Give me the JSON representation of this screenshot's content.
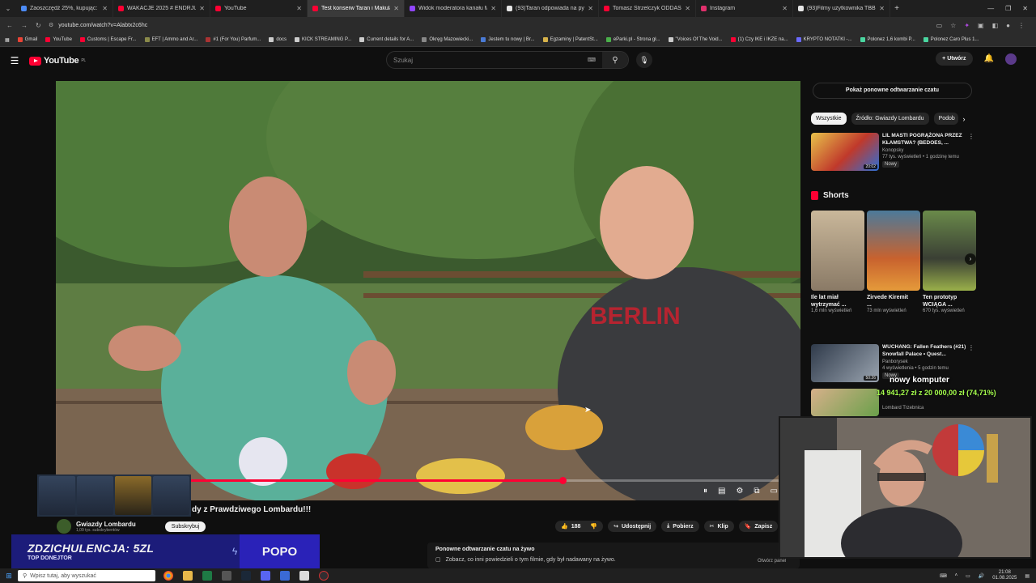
{
  "tabs": [
    {
      "title": "Zaoszczędź 25%, kupując: Bus I",
      "color": "#4c8bf5",
      "active": false
    },
    {
      "title": "WAKACJE 2025 # ENDRJU # ENTER",
      "color": "#ff0033",
      "active": false
    },
    {
      "title": "YouTube",
      "color": "#ff0033",
      "active": false
    },
    {
      "title": "Test konserw Taran i Makulach",
      "color": "#ff0033",
      "active": true
    },
    {
      "title": "Widok moderatora kanału Mar",
      "color": "#9146ff",
      "active": false
    },
    {
      "title": "(93)Taran odpowiada na pytani",
      "color": "#e6e6e6",
      "active": false
    },
    {
      "title": "Tomasz Strzelczyk ODDASZFAR",
      "color": "#ff0033",
      "active": false
    },
    {
      "title": "Instagram",
      "color": "#e1306c",
      "active": false
    },
    {
      "title": "(93)Filmy użytkownika TBBUPC",
      "color": "#e6e6e6",
      "active": false
    }
  ],
  "address": {
    "url": "youtube.com/watch?v=Alabtx2c6hc"
  },
  "bookmarks": [
    {
      "label": "Gmail",
      "color": "#ea4335"
    },
    {
      "label": "YouTube",
      "color": "#ff0033"
    },
    {
      "label": "Customs | Escape Fr...",
      "color": "#ff0033"
    },
    {
      "label": "EFT | Ammo and Ar...",
      "color": "#8a8a4a"
    },
    {
      "label": "#1 (For You) Parfum...",
      "color": "#aa3333"
    },
    {
      "label": "docs",
      "color": "#cccccc"
    },
    {
      "label": "KICK STREAMING P...",
      "color": "#cccccc"
    },
    {
      "label": "Current details for A...",
      "color": "#cccccc"
    },
    {
      "label": "Okręg Mazowiecki...",
      "color": "#888888"
    },
    {
      "label": "Jestem tu nowy | Br...",
      "color": "#4a7bd6"
    },
    {
      "label": "Egzaminy | PatentSt...",
      "color": "#d6b24a"
    },
    {
      "label": "eParki.pl - Strona gł...",
      "color": "#4ab04a"
    },
    {
      "label": "\"Voices Of The Void...",
      "color": "#cccccc"
    },
    {
      "label": "(1) Czy IKE i IKZE na...",
      "color": "#ff0033"
    },
    {
      "label": "KRYPTO NOTATKI -...",
      "color": "#6a6aff"
    },
    {
      "label": "Polonez 1,6 kombi P...",
      "color": "#4ad6a0"
    },
    {
      "label": "Polonez Caro Plus 1...",
      "color": "#4ad6a0"
    }
  ],
  "header": {
    "logo_text": "YouTube",
    "logo_region": "PL",
    "search_placeholder": "Szukaj",
    "create_label": "Utwórz"
  },
  "player": {
    "progress_fraction": 0.68
  },
  "video": {
    "title": "dy z Prawdziwego Lombardu!!!",
    "channel_name": "Gwiazdy Lombardu",
    "channel_subs": "1,09 tys. subskrybentów",
    "subscribe_label": "Subskrybuj",
    "likes": "188",
    "share_label": "Udostępnij",
    "download_label": "Pobierz",
    "clip_label": "Klip",
    "save_label": "Zapisz"
  },
  "chat_replay": {
    "title": "Ponowne odtwarzanie czatu na żywo",
    "body": "Zobacz, co inni powiedzieli o tym filmie, gdy był nadawany na żywo.",
    "open_panel": "Otwórz panel"
  },
  "sidebar": {
    "show_chat": "Pokaż ponowne odtwarzanie czatu",
    "chips": [
      "Wszystkie",
      "Źródło: Gwiazdy Lombardu",
      "Podob"
    ],
    "rec1": {
      "title": "LIL MASTI POGRĄŻONA PRZEZ KŁAMSTWA? (BEDOES, ...",
      "channel": "Konopsky",
      "views": "77 tys. wyświetleń • 1 godzinę temu",
      "badge": "Nowy",
      "duration": "20:02"
    },
    "shorts_label": "Shorts",
    "shorts": [
      {
        "title": "Ile lat miał wytrzymać ...",
        "views": "1,6 mln wyświetleń"
      },
      {
        "title": "Zirvede Kiremit ...",
        "views": "73 mln wyświetleń"
      },
      {
        "title": "Ten prototyp WCIĄGA ...",
        "views": "670 tys. wyświetleń"
      }
    ],
    "rec2": {
      "title": "WUCHANG: Fallen Feathers (#21) Snowfall Palace • Quest...",
      "channel": "Panborysek",
      "views": "4 wyświetlenia • 5 godzin temu",
      "badge": "Nowy",
      "duration": "50:26"
    },
    "rec3": {
      "channel": "Lombard Trzebnica"
    }
  },
  "stream_overlay": {
    "donation_main": "ZDZICHULENCJA: 5ZL",
    "donation_sub": "TOP DONEJTOR",
    "donation_right": "POPO",
    "goal_label": "nowy komputer",
    "goal_value": "14 941,27 zł z 20 000,00 zł (74,71%)"
  },
  "taskbar": {
    "search_placeholder": "Wpisz tutaj, aby wyszukać",
    "time": "21:08",
    "date": "01.08.2025"
  }
}
